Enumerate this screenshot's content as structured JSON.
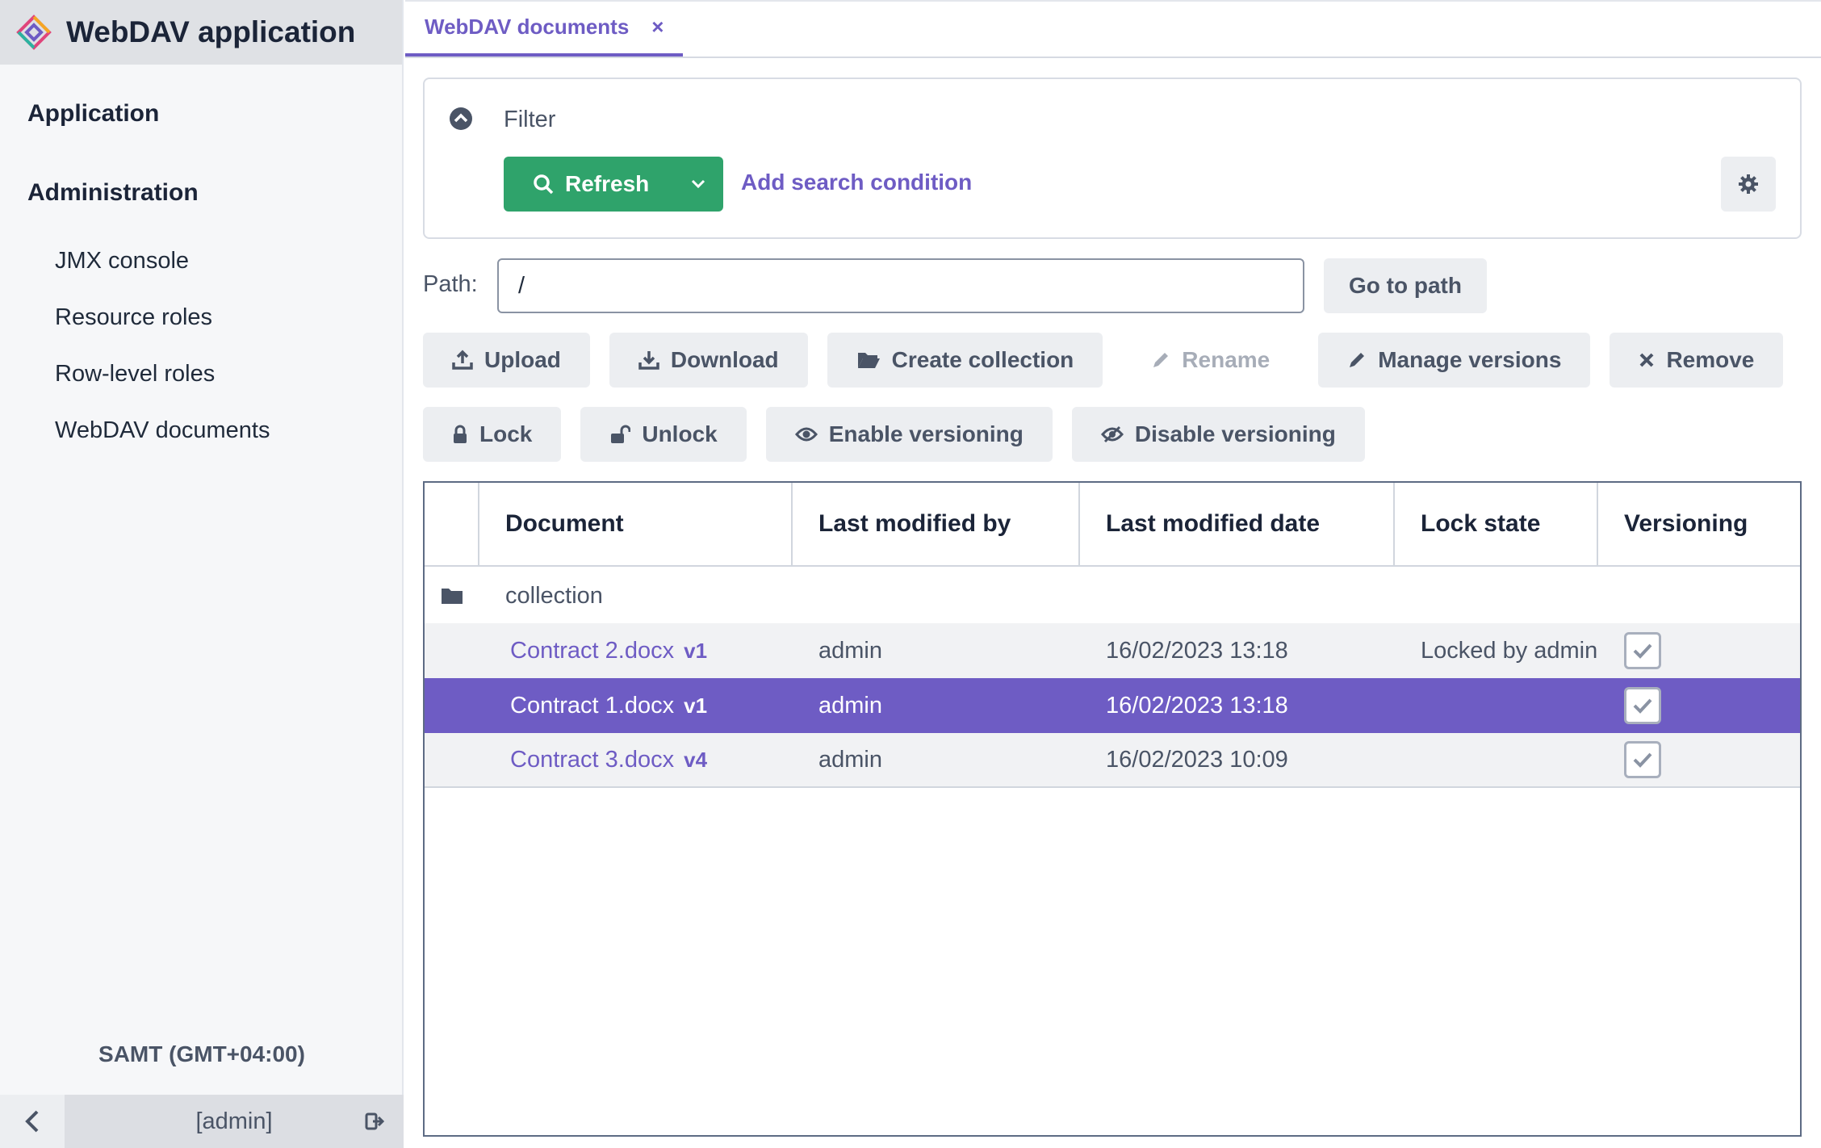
{
  "app": {
    "title": "WebDAV application"
  },
  "sidebar": {
    "groups": [
      {
        "label": "Application"
      },
      {
        "label": "Administration"
      }
    ],
    "items": [
      {
        "label": "JMX console"
      },
      {
        "label": "Resource roles"
      },
      {
        "label": "Row-level roles"
      },
      {
        "label": "WebDAV documents"
      }
    ],
    "timezone": "SAMT (GMT+04:00)",
    "user": "[admin]"
  },
  "tabs": [
    {
      "label": "WebDAV documents",
      "close": "×"
    }
  ],
  "filter": {
    "label": "Filter",
    "refresh_label": "Refresh",
    "add_condition_label": "Add search condition"
  },
  "path": {
    "label": "Path:",
    "value": "/",
    "go_label": "Go to path"
  },
  "toolbar": {
    "upload": "Upload",
    "download": "Download",
    "create_collection": "Create collection",
    "rename": "Rename",
    "manage_versions": "Manage versions",
    "remove": "Remove",
    "lock": "Lock",
    "unlock": "Unlock",
    "enable_versioning": "Enable versioning",
    "disable_versioning": "Disable versioning"
  },
  "table": {
    "columns": [
      "Document",
      "Last modified by",
      "Last modified date",
      "Lock state",
      "Versioning"
    ],
    "rows": [
      {
        "document": "collection",
        "version": "",
        "modified_by": "",
        "modified_date": "",
        "lock_state": "",
        "versioning": null,
        "type": "folder"
      },
      {
        "document": "Contract 2.docx",
        "version": "v1",
        "modified_by": "admin",
        "modified_date": "16/02/2023 13:18",
        "lock_state": "Locked by admin",
        "versioning": true,
        "type": "file"
      },
      {
        "document": "Contract 1.docx",
        "version": "v1",
        "modified_by": "admin",
        "modified_date": "16/02/2023 13:18",
        "lock_state": "",
        "versioning": true,
        "type": "file",
        "selected": true
      },
      {
        "document": "Contract 3.docx",
        "version": "v4",
        "modified_by": "admin",
        "modified_date": "16/02/2023 10:09",
        "lock_state": "",
        "versioning": true,
        "type": "file"
      }
    ]
  },
  "colors": {
    "accent": "#6e5cc4",
    "primary_button": "#2fa36b",
    "sidebar_bg": "#f6f7f9",
    "button_bg": "#eceef1"
  }
}
